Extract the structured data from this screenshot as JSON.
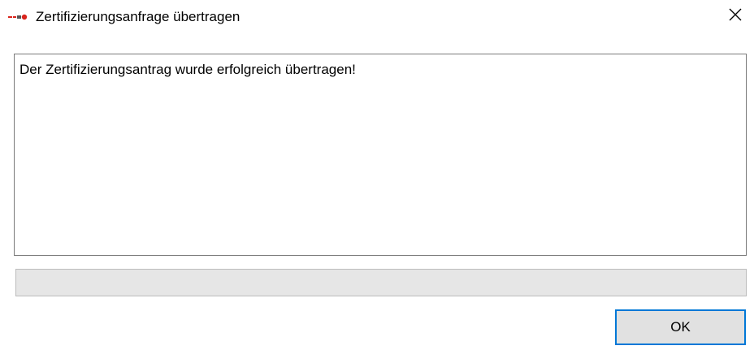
{
  "window": {
    "title": "Zertifizierungsanfrage übertragen",
    "app_icon": "app-logo-icon",
    "close_icon": "close-icon"
  },
  "message": {
    "text": "Der Zertifizierungsantrag wurde erfolgreich übertragen!"
  },
  "progress": {
    "value": 0
  },
  "buttons": {
    "ok_label": "OK"
  },
  "colors": {
    "accent_border": "#0078d7",
    "button_face": "#e1e1e1",
    "progress_track": "#e6e6e6",
    "text_border": "#7a7a7a",
    "icon_red": "#d9251d"
  }
}
